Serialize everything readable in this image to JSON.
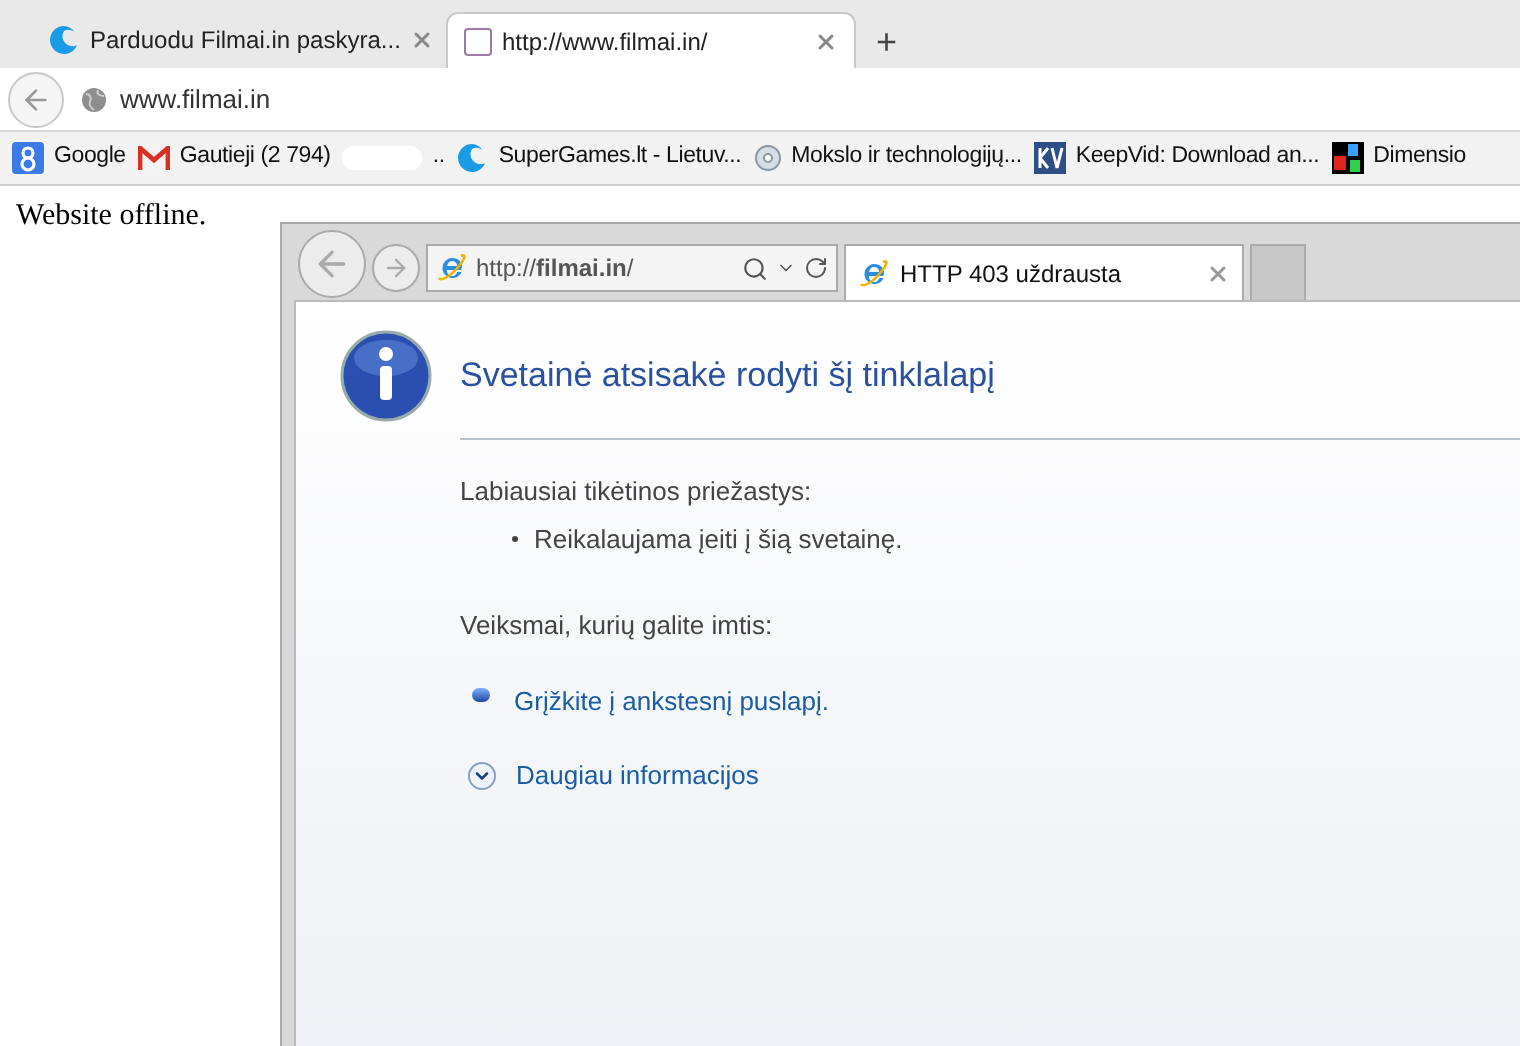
{
  "tabs": [
    {
      "title": "Parduodu Filmai.in paskyra...",
      "selected": false,
      "kind": "crescent"
    },
    {
      "title": "http://www.filmai.in/",
      "selected": true,
      "kind": "blank"
    }
  ],
  "new_tab": "+",
  "address": {
    "value": "www.filmai.in"
  },
  "bookmarks": [
    {
      "label": "Google",
      "kind": "google"
    },
    {
      "label": "Gautieji (2 794)",
      "kind": "mail"
    },
    {
      "label": "..",
      "kind": "none"
    },
    {
      "label": "SuperGames.lt - Lietuv...",
      "kind": "crescent"
    },
    {
      "label": "Mokslo ir technologijų...",
      "kind": "disc"
    },
    {
      "label": "KeepVid: Download an...",
      "kind": "kv"
    },
    {
      "label": "Dimensio",
      "kind": "abc"
    }
  ],
  "page": {
    "text": "Website offline.",
    "screenshot": {
      "address": "http://**filmai.in**/",
      "tab": "HTTP 403 uždrausta",
      "heading": "Svetainė atsisakė rodyti šį tinklalapį",
      "reasons_label": "Labiausiai tikėtinos priežastys:",
      "reasons": [
        "Reikalaujama įeiti į šią svetainę."
      ],
      "actions_label": "Veiksmai, kurių galite imtis:",
      "actions": [
        {
          "kind": "bullet",
          "text": "Grįžkite į ankstesnį puslapį."
        },
        {
          "kind": "expand",
          "text": "Daugiau informacijos"
        }
      ]
    }
  }
}
